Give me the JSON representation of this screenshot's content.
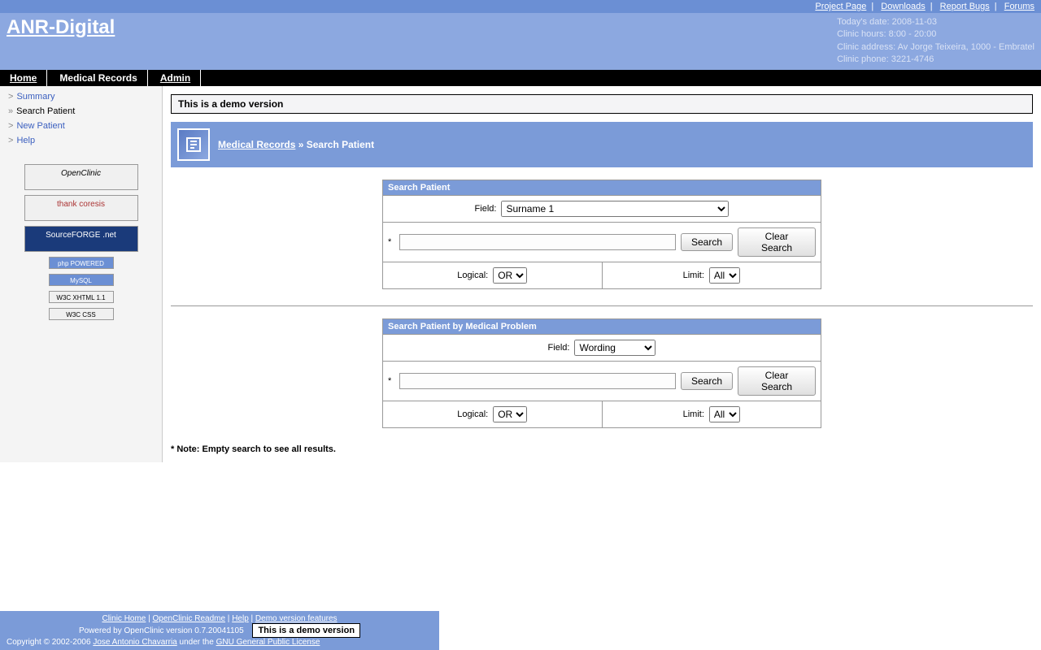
{
  "topLinks": {
    "project": "Project Page",
    "downloads": "Downloads",
    "bugs": "Report Bugs",
    "forums": "Forums"
  },
  "header": {
    "title": "ANR-Digital",
    "date": "Today's date: 2008-11-03",
    "hours": "Clinic hours: 8:00 - 20:00",
    "address": "Clinic address: Av Jorge Teixeira, 1000 - Embratel",
    "phone": "Clinic phone: 3221-4746"
  },
  "nav": {
    "home": "Home",
    "medical": "Medical Records",
    "admin": "Admin"
  },
  "sidebar": {
    "summary": "Summary",
    "search": "Search Patient",
    "new": "New Patient",
    "help": "Help"
  },
  "badges": {
    "openclinic": "OpenClinic",
    "coresis": "thank coresis",
    "sourceforge": "SourceFORGE .net",
    "php": "php POWERED",
    "mysql": "MySQL",
    "xhtml": "W3C XHTML 1.1",
    "css": "W3C CSS"
  },
  "main": {
    "demoBanner": "This is a demo version",
    "breadcrumb": {
      "link": "Medical Records",
      "sep": "»",
      "current": "Search Patient"
    },
    "form1": {
      "title": "Search Patient",
      "fieldLabel": "Field:",
      "fieldValue": "Surname 1",
      "searchBtn": "Search",
      "clearBtn": "Clear Search",
      "logicalLabel": "Logical:",
      "logicalValue": "OR",
      "limitLabel": "Limit:",
      "limitValue": "All"
    },
    "form2": {
      "title": "Search Patient by Medical Problem",
      "fieldLabel": "Field:",
      "fieldValue": "Wording",
      "searchBtn": "Search",
      "clearBtn": "Clear Search",
      "logicalLabel": "Logical:",
      "logicalValue": "OR",
      "limitLabel": "Limit:",
      "limitValue": "All"
    },
    "note": "* Note: Empty search to see all results."
  },
  "footer": {
    "link1": "Clinic Home",
    "link2": "OpenClinic Readme",
    "link3": "Help",
    "link4": "Demo version features",
    "powered": "Powered by OpenClinic version 0.7.20041105",
    "demoBox": "This is a demo version",
    "copyright": "Copyright © 2002-2006 ",
    "author": "Jose Antonio Chavarria",
    "under": " under the ",
    "gpl": "GNU General Public License"
  }
}
